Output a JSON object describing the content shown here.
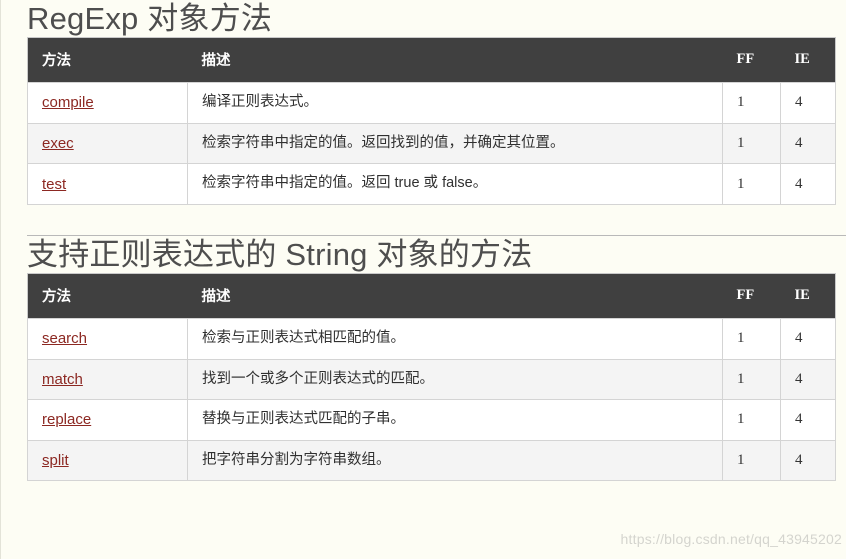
{
  "page": {
    "background_color": "#fdfdf4",
    "header_bg_color": "#404040",
    "link_color": "#8c2822",
    "heading_color": "#4e4e4e"
  },
  "watermark": {
    "text": "https://blog.csdn.net/qq_43945202"
  },
  "sections": [
    {
      "title": "RegExp 对象方法",
      "table": {
        "columns": [
          "方法",
          "描述",
          "FF",
          "IE"
        ],
        "rows": [
          {
            "method": "compile",
            "desc": "编译正则表达式。",
            "ff": "1",
            "ie": "4"
          },
          {
            "method": "exec",
            "desc": "检索字符串中指定的值。返回找到的值，并确定其位置。",
            "ff": "1",
            "ie": "4"
          },
          {
            "method": "test",
            "desc": "检索字符串中指定的值。返回 true 或 false。",
            "ff": "1",
            "ie": "4"
          }
        ]
      }
    },
    {
      "title": "支持正则表达式的 String 对象的方法",
      "table": {
        "columns": [
          "方法",
          "描述",
          "FF",
          "IE"
        ],
        "rows": [
          {
            "method": "search",
            "desc": "检索与正则表达式相匹配的值。",
            "ff": "1",
            "ie": "4"
          },
          {
            "method": "match",
            "desc": "找到一个或多个正则表达式的匹配。",
            "ff": "1",
            "ie": "4"
          },
          {
            "method": "replace",
            "desc": "替换与正则表达式匹配的子串。",
            "ff": "1",
            "ie": "4"
          },
          {
            "method": "split",
            "desc": "把字符串分割为字符串数组。",
            "ff": "1",
            "ie": "4"
          }
        ]
      }
    }
  ]
}
